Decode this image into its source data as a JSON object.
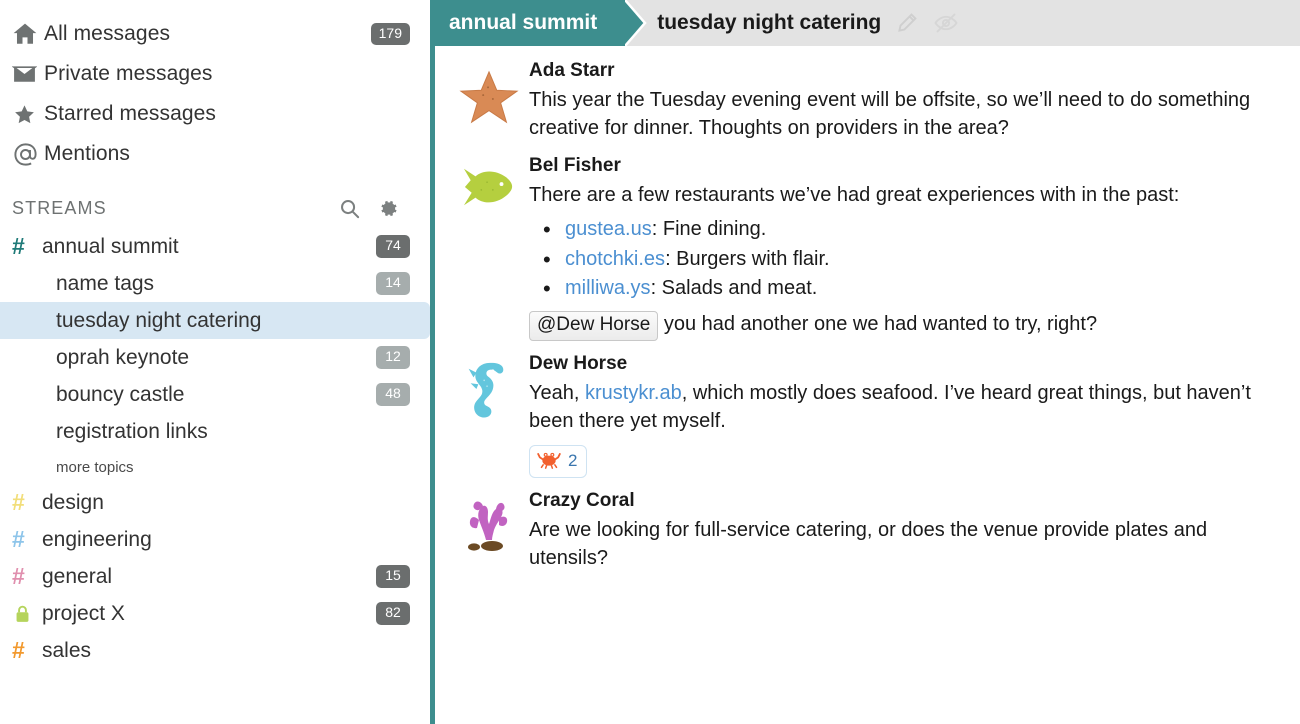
{
  "sidebar": {
    "nav": [
      {
        "icon": "home-icon",
        "label": "All messages",
        "badge": "179"
      },
      {
        "icon": "envelope-icon",
        "label": "Private messages",
        "badge": ""
      },
      {
        "icon": "star-icon",
        "label": "Starred messages",
        "badge": ""
      },
      {
        "icon": "at-icon",
        "label": "Mentions",
        "badge": ""
      }
    ],
    "streams_title": "STREAMS",
    "streams_search_icon": "search-icon",
    "streams_gear_icon": "gear-icon",
    "streams": [
      {
        "name": "annual summit",
        "mark": "#",
        "color": "#1f7a78",
        "badge": "74",
        "topics": [
          {
            "name": "name tags",
            "badge": "14",
            "selected": false
          },
          {
            "name": "tuesday night catering",
            "badge": "",
            "selected": true
          },
          {
            "name": "oprah keynote",
            "badge": "12",
            "selected": false
          },
          {
            "name": "bouncy castle",
            "badge": "48",
            "selected": false
          },
          {
            "name": "registration links",
            "badge": "",
            "selected": false
          }
        ],
        "more_topics": "more topics"
      },
      {
        "name": "design",
        "mark": "#",
        "color": "#f2de7a",
        "badge": "",
        "topics": [],
        "more_topics": ""
      },
      {
        "name": "engineering",
        "mark": "#",
        "color": "#8ec5ea",
        "badge": "",
        "topics": [],
        "more_topics": ""
      },
      {
        "name": "general",
        "mark": "#",
        "color": "#e08fae",
        "badge": "15",
        "topics": [],
        "more_topics": ""
      },
      {
        "name": "project X",
        "mark": "lock-icon",
        "color": "#b5d45c",
        "badge": "82",
        "topics": [],
        "more_topics": ""
      },
      {
        "name": "sales",
        "mark": "#",
        "color": "#f2992e",
        "badge": "",
        "topics": [],
        "more_topics": ""
      }
    ]
  },
  "header": {
    "stream": "annual summit",
    "topic": "tuesday night catering",
    "edit_icon": "pencil-icon",
    "mute_icon": "eye-slash-icon",
    "accent_color": "#3d8e8e",
    "bar_color": "#e3e3e3"
  },
  "messages": [
    {
      "avatar": "starfish-icon",
      "sender": "Ada Starr",
      "text": "This year the Tuesday evening event will be offsite, so we’ll need to do something creative for dinner. Thoughts on providers in the area?"
    },
    {
      "avatar": "fish-icon",
      "sender": "Bel Fisher",
      "text": "There are a few restaurants we’ve had great experiences with in the past:",
      "list": [
        {
          "link": "gustea.us",
          "rest": ": Fine dining."
        },
        {
          "link": "chotchki.es",
          "rest": ": Burgers with flair."
        },
        {
          "link": "milliwa.ys",
          "rest": ": Salads and meat."
        }
      ],
      "mention": "@Dew Horse",
      "mention_rest": "you had another one we had wanted to try, right?"
    },
    {
      "avatar": "seahorse-icon",
      "sender": "Dew Horse",
      "text_before": "Yeah, ",
      "link": "krustykr.ab",
      "text_after": ", which mostly does seafood. I’ve heard great things, but haven’t been there yet myself.",
      "reaction": {
        "emoji": "crab-icon",
        "count": "2"
      }
    },
    {
      "avatar": "coral-icon",
      "sender": "Crazy Coral",
      "text": "Are we looking for full-service catering, or does the venue provide plates and utensils?"
    }
  ]
}
